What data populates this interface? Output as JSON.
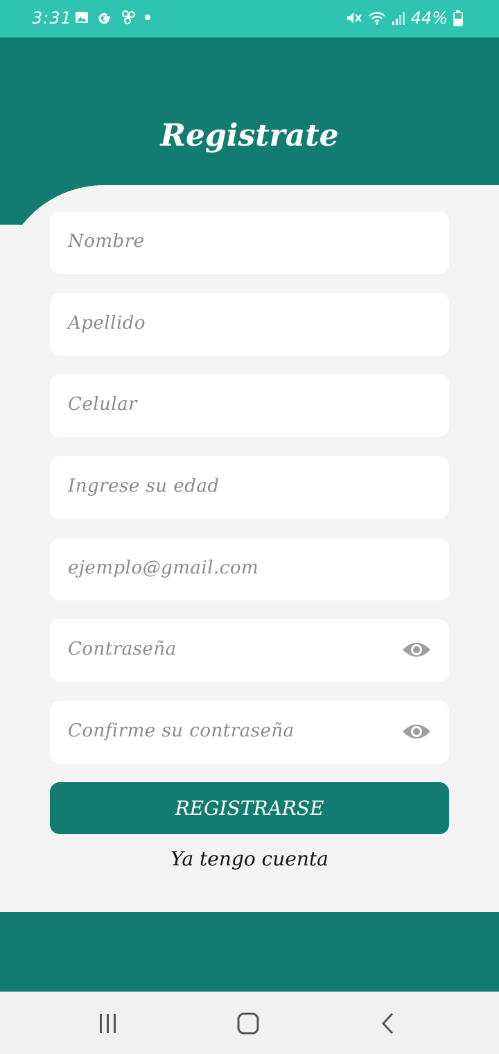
{
  "status_bar": {
    "time": "3:31",
    "battery": "44%"
  },
  "header": {
    "title": "Registrate"
  },
  "form": {
    "fields": [
      {
        "placeholder": "Nombre"
      },
      {
        "placeholder": "Apellido"
      },
      {
        "placeholder": "Celular"
      },
      {
        "placeholder": "Ingrese su edad"
      },
      {
        "placeholder": "ejemplo@gmail.com"
      },
      {
        "placeholder": "Contraseña",
        "trailing_icon": "eye-icon"
      },
      {
        "placeholder": "Confirme su contraseña",
        "trailing_icon": "eye-icon"
      }
    ],
    "submit_label": "REGISTRARSE",
    "login_link": "Ya tengo cuenta"
  },
  "nav": {
    "icons": [
      "recent-apps-icon",
      "home-icon",
      "back-icon"
    ]
  },
  "colors": {
    "accent": "#137c70",
    "status_bar": "#2ec4b0",
    "background": "#f4f4f4"
  }
}
